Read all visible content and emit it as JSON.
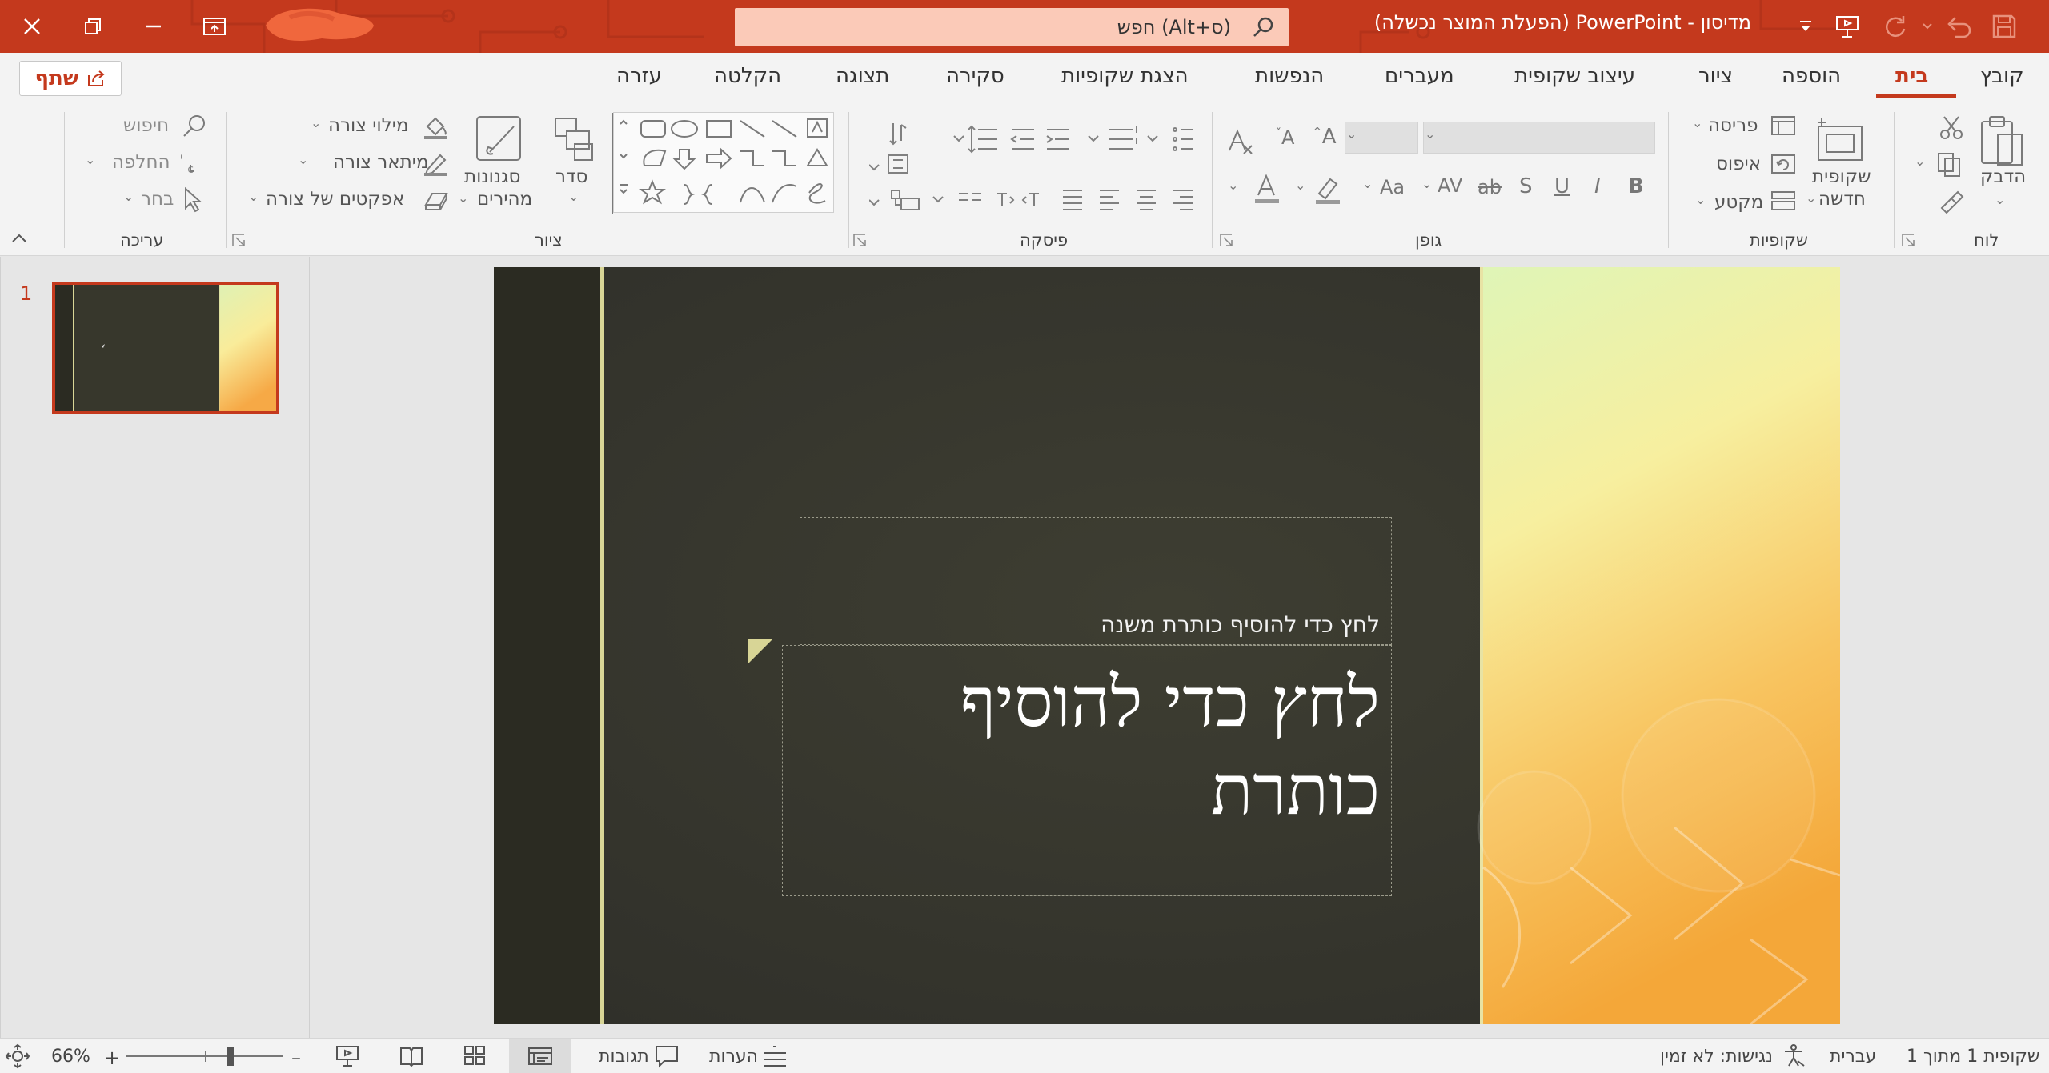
{
  "app": {
    "document_title": "מדיסון - PowerPoint (הפעלת המוצר נכשלה)",
    "search_label": "חפש (Alt+ס)"
  },
  "ribbon_tabs": [
    {
      "label": "קובץ"
    },
    {
      "label": "בית",
      "active": true
    },
    {
      "label": "הוספה"
    },
    {
      "label": "ציור"
    },
    {
      "label": "עיצוב שקופית"
    },
    {
      "label": "מעברים"
    },
    {
      "label": "הנפשות"
    },
    {
      "label": "הצגת שקופיות"
    },
    {
      "label": "סקירה"
    },
    {
      "label": "תצוגה"
    },
    {
      "label": "הקלטה"
    },
    {
      "label": "עזרה"
    }
  ],
  "share_label": "שתף",
  "groups": {
    "clipboard": {
      "label": "לוח",
      "paste": "הדבק"
    },
    "slides": {
      "label": "שקופיות",
      "new_slide_1": "שקופית",
      "new_slide_2": "חדשה",
      "layout": "פריסה",
      "reset": "איפוס",
      "section": "מקטע"
    },
    "font": {
      "label": "גופן",
      "bold": "B",
      "italic": "I",
      "underline": "U",
      "strike": "ab",
      "change_case": "Aa"
    },
    "paragraph": {
      "label": "פיסקה"
    },
    "drawing": {
      "label": "ציור",
      "arrange": "סדר",
      "quick_styles_1": "סגנונות",
      "quick_styles_2": "מהירים",
      "shape_fill": "מילוי צורה",
      "shape_outline": "מיתאר צורה",
      "shape_effects": "אפקטים של צורה"
    },
    "editing": {
      "label": "עריכה",
      "find": "חיפוש",
      "replace": "החלפה",
      "select": "בחר"
    }
  },
  "thumbnail": {
    "number": "1"
  },
  "slide": {
    "subtitle_placeholder": "לחץ כדי להוסיף כותרת משנה",
    "title_line1": "לחץ כדי להוסיף",
    "title_line2": "כותרת"
  },
  "status": {
    "slide_counter": "שקופית 1 מתוך 1",
    "language": "עברית",
    "accessibility": "נגישות: לא זמין",
    "notes": "הערות",
    "comments": "תגובות",
    "zoom": "66%"
  },
  "colors": {
    "accent": "#c4391d",
    "slide_background": "#37372c",
    "slide_stripe": "#d8d596"
  }
}
